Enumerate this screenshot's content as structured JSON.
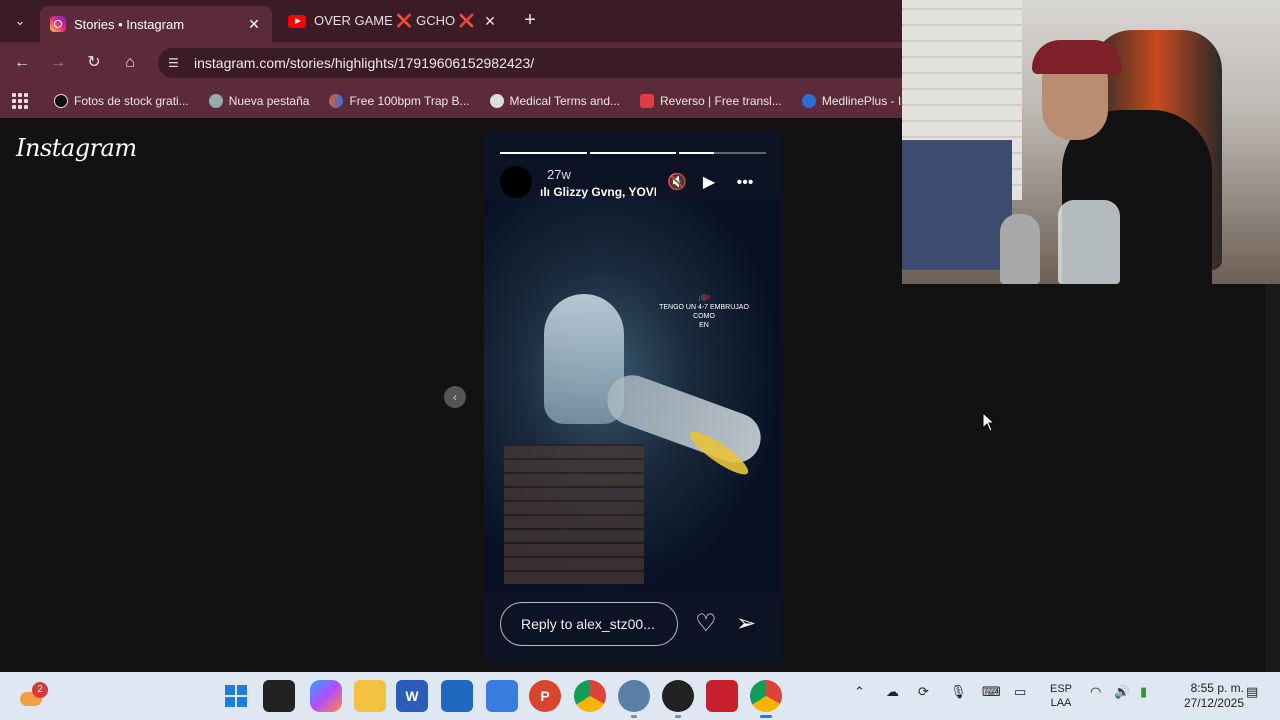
{
  "browser": {
    "tabs": [
      {
        "title": "Stories • Instagram",
        "active": true
      },
      {
        "title": "OVER GAME ❌ GCHO ❌ LUIS",
        "active": false
      }
    ],
    "url": "instagram.com/stories/highlights/17919606152982423/",
    "bookmarks": [
      {
        "label": "Fotos de stock grati..."
      },
      {
        "label": "Nueva pestaña"
      },
      {
        "label": "Free 100bpm Trap B..."
      },
      {
        "label": "Medical Terms and..."
      },
      {
        "label": "Reverso | Free transl..."
      },
      {
        "label": "MedlinePlus - Inf"
      }
    ]
  },
  "instagram": {
    "logo": "Instagram",
    "story": {
      "time": "27w",
      "music": "Glizzy Gvng, YOVN",
      "overlay_line1": "¡😡!",
      "overlay_line2": "TENGO UN 4-7 EMBRUJAO COMO",
      "overlay_line3": "EN",
      "reply_placeholder": "Reply to alex_stz00...",
      "progress_segments": [
        1.0,
        1.0,
        0.4
      ]
    }
  },
  "taskbar": {
    "weather_badge": "2",
    "lang_line1": "ESP",
    "lang_line2": "LAA",
    "time": "8:55 p. m.",
    "date": "27/12/2025"
  },
  "colors": {
    "tabstrip": "#3b1b25",
    "toolbar": "#5c2b3a",
    "page_bg": "#121212",
    "taskbar": "#dfe7f2"
  }
}
